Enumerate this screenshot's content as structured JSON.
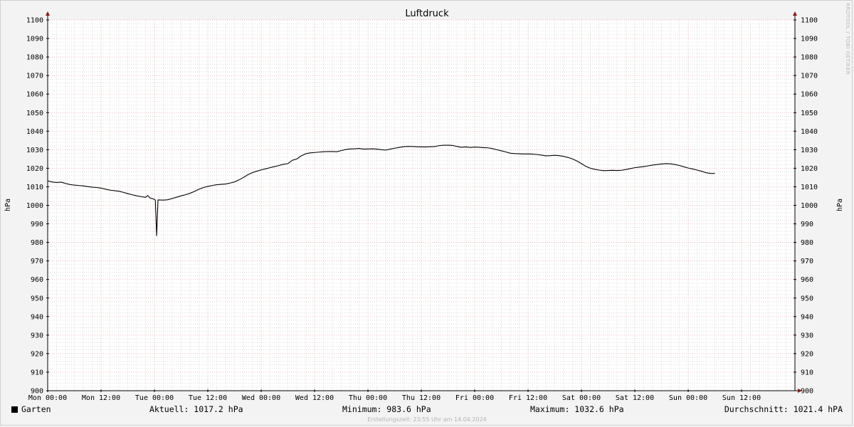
{
  "chart_data": {
    "type": "line",
    "title": "Luftdruck",
    "ylabel": "hPa",
    "ylabel_right": "hPa",
    "ylim": [
      900,
      1100
    ],
    "y_major_ticks": [
      900,
      910,
      920,
      930,
      940,
      950,
      960,
      970,
      980,
      990,
      1000,
      1010,
      1020,
      1030,
      1040,
      1050,
      1060,
      1070,
      1080,
      1090,
      1100
    ],
    "xlim_hours": [
      0,
      168
    ],
    "x_tick_hours": [
      0,
      12,
      24,
      36,
      48,
      60,
      72,
      84,
      96,
      108,
      120,
      132,
      144,
      156
    ],
    "x_tick_labels": [
      "Mon 00:00",
      "Mon 12:00",
      "Tue 00:00",
      "Tue 12:00",
      "Wed 00:00",
      "Wed 12:00",
      "Thu 00:00",
      "Thu 12:00",
      "Fri 00:00",
      "Fri 12:00",
      "Sat 00:00",
      "Sat 12:00",
      "Sun 00:00",
      "Sun 12:00"
    ],
    "grid": true,
    "series": [
      {
        "name": "Garten",
        "color": "#000000",
        "points": [
          [
            0,
            1013.2
          ],
          [
            1,
            1012.6
          ],
          [
            2,
            1012.3
          ],
          [
            3,
            1012.5
          ],
          [
            4,
            1011.8
          ],
          [
            5,
            1011.2
          ],
          [
            6,
            1010.9
          ],
          [
            7,
            1010.7
          ],
          [
            8,
            1010.5
          ],
          [
            9,
            1010.1
          ],
          [
            10,
            1009.8
          ],
          [
            11,
            1009.6
          ],
          [
            12,
            1009.3
          ],
          [
            13,
            1008.7
          ],
          [
            14,
            1008.2
          ],
          [
            15,
            1007.9
          ],
          [
            16,
            1007.6
          ],
          [
            17,
            1007.0
          ],
          [
            18,
            1006.3
          ],
          [
            19,
            1005.7
          ],
          [
            20,
            1005.1
          ],
          [
            21,
            1004.7
          ],
          [
            22,
            1004.3
          ],
          [
            22.5,
            1005.3
          ],
          [
            23,
            1004.0
          ],
          [
            24,
            1003.2
          ],
          [
            24.2,
            1002.8
          ],
          [
            24.5,
            983.6
          ],
          [
            24.8,
            1002.9
          ],
          [
            26,
            1002.8
          ],
          [
            27,
            1003.0
          ],
          [
            28,
            1003.7
          ],
          [
            29,
            1004.4
          ],
          [
            30,
            1005.1
          ],
          [
            31,
            1005.7
          ],
          [
            32,
            1006.5
          ],
          [
            33,
            1007.5
          ],
          [
            34,
            1008.7
          ],
          [
            35,
            1009.6
          ],
          [
            36,
            1010.2
          ],
          [
            37,
            1010.7
          ],
          [
            38,
            1011.1
          ],
          [
            39,
            1011.3
          ],
          [
            40,
            1011.5
          ],
          [
            41,
            1012.0
          ],
          [
            42,
            1012.6
          ],
          [
            43,
            1013.7
          ],
          [
            44,
            1015.0
          ],
          [
            45,
            1016.5
          ],
          [
            46,
            1017.6
          ],
          [
            47,
            1018.4
          ],
          [
            48,
            1019.1
          ],
          [
            49,
            1019.7
          ],
          [
            50,
            1020.3
          ],
          [
            51,
            1020.9
          ],
          [
            52,
            1021.5
          ],
          [
            53,
            1022.1
          ],
          [
            54,
            1022.5
          ],
          [
            55,
            1024.3
          ],
          [
            56,
            1025.0
          ],
          [
            57,
            1026.7
          ],
          [
            58,
            1027.8
          ],
          [
            59,
            1028.3
          ],
          [
            60,
            1028.5
          ],
          [
            61,
            1028.7
          ],
          [
            62,
            1028.9
          ],
          [
            63,
            1029.0
          ],
          [
            64,
            1029.0
          ],
          [
            65,
            1028.9
          ],
          [
            66,
            1029.5
          ],
          [
            67,
            1030.1
          ],
          [
            68,
            1030.4
          ],
          [
            69,
            1030.5
          ],
          [
            70,
            1030.7
          ],
          [
            71,
            1030.3
          ],
          [
            72,
            1030.4
          ],
          [
            73,
            1030.5
          ],
          [
            74,
            1030.3
          ],
          [
            75,
            1030.0
          ],
          [
            76,
            1029.8
          ],
          [
            77,
            1030.3
          ],
          [
            78,
            1030.8
          ],
          [
            79,
            1031.2
          ],
          [
            80,
            1031.6
          ],
          [
            81,
            1031.8
          ],
          [
            82,
            1031.7
          ],
          [
            83,
            1031.6
          ],
          [
            84,
            1031.5
          ],
          [
            85,
            1031.5
          ],
          [
            86,
            1031.6
          ],
          [
            87,
            1031.7
          ],
          [
            88,
            1032.2
          ],
          [
            89,
            1032.4
          ],
          [
            90,
            1032.4
          ],
          [
            91,
            1032.3
          ],
          [
            92,
            1031.8
          ],
          [
            93,
            1031.3
          ],
          [
            94,
            1031.5
          ],
          [
            95,
            1031.2
          ],
          [
            96,
            1031.4
          ],
          [
            97,
            1031.3
          ],
          [
            98,
            1031.1
          ],
          [
            99,
            1031.0
          ],
          [
            100,
            1030.6
          ],
          [
            101,
            1030.0
          ],
          [
            102,
            1029.4
          ],
          [
            103,
            1028.8
          ],
          [
            104,
            1028.1
          ],
          [
            105,
            1027.9
          ],
          [
            106,
            1027.8
          ],
          [
            107,
            1027.7
          ],
          [
            108,
            1027.7
          ],
          [
            109,
            1027.6
          ],
          [
            110,
            1027.4
          ],
          [
            111,
            1027.1
          ],
          [
            112,
            1026.7
          ],
          [
            113,
            1026.8
          ],
          [
            114,
            1027.0
          ],
          [
            115,
            1026.8
          ],
          [
            116,
            1026.4
          ],
          [
            117,
            1025.8
          ],
          [
            118,
            1025.0
          ],
          [
            119,
            1023.9
          ],
          [
            120,
            1022.5
          ],
          [
            121,
            1021.0
          ],
          [
            122,
            1020.0
          ],
          [
            123,
            1019.4
          ],
          [
            124,
            1019.0
          ],
          [
            125,
            1018.7
          ],
          [
            126,
            1018.8
          ],
          [
            127,
            1018.9
          ],
          [
            128,
            1018.8
          ],
          [
            129,
            1018.9
          ],
          [
            130,
            1019.3
          ],
          [
            131,
            1019.8
          ],
          [
            132,
            1020.3
          ],
          [
            133,
            1020.6
          ],
          [
            134,
            1020.9
          ],
          [
            135,
            1021.3
          ],
          [
            136,
            1021.7
          ],
          [
            137,
            1022.0
          ],
          [
            138,
            1022.3
          ],
          [
            139,
            1022.5
          ],
          [
            140,
            1022.4
          ],
          [
            141,
            1022.0
          ],
          [
            142,
            1021.5
          ],
          [
            143,
            1020.8
          ],
          [
            144,
            1020.1
          ],
          [
            145,
            1019.6
          ],
          [
            146,
            1019.0
          ],
          [
            147,
            1018.4
          ],
          [
            148,
            1017.6
          ],
          [
            149,
            1017.2
          ],
          [
            150,
            1017.2
          ]
        ]
      }
    ]
  },
  "legend": {
    "series_name": "Garten",
    "current": "Aktuell: 1017.2 hPa",
    "minimum": "Minimum: 983.6 hPa",
    "maximum": "Maximum: 1032.6 hPa",
    "average": "Durchschnitt: 1021.4 hPA"
  },
  "footer": "Erstellungszeit: 23:55 Uhr am 14.04.2024",
  "watermark": "RRDTOOL / TOBI OETIKER",
  "colors": {
    "background": "#f3f3f3",
    "plot_area": "#ffffff",
    "major_grid": "#e4a0a0",
    "minor_grid": "#c8c8c8",
    "axis_arrow": "#8b1a1a",
    "line": "#000000"
  }
}
